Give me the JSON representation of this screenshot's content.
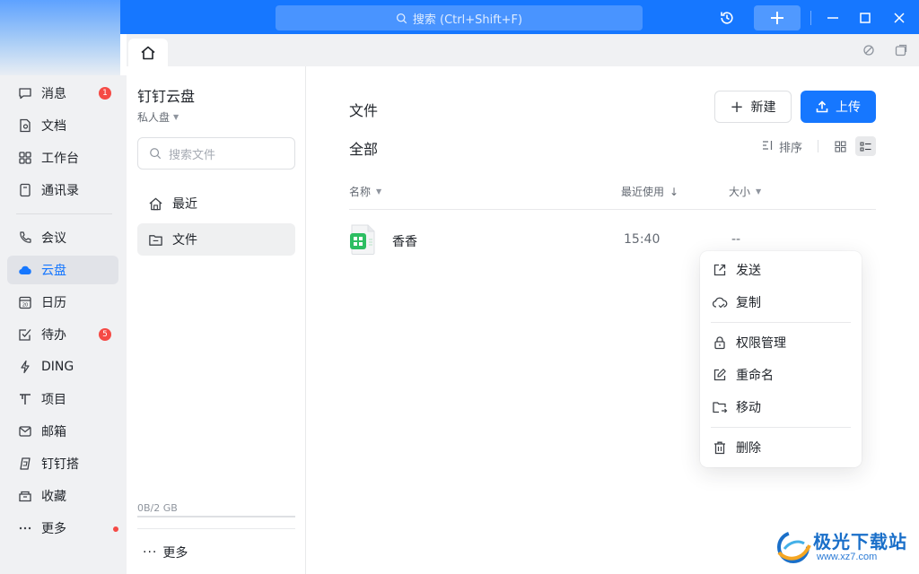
{
  "titlebar": {
    "search_placeholder": "搜索 (Ctrl+Shift+F)",
    "accent_color": "#1677ff"
  },
  "leftnav": {
    "items": [
      {
        "label": "消息",
        "icon": "message-icon",
        "badge": "1"
      },
      {
        "label": "文档",
        "icon": "document-icon"
      },
      {
        "label": "工作台",
        "icon": "workbench-icon"
      },
      {
        "label": "通讯录",
        "icon": "contacts-icon"
      },
      {
        "label": "会议",
        "icon": "meeting-icon"
      },
      {
        "label": "云盘",
        "icon": "cloud-icon",
        "active": true
      },
      {
        "label": "日历",
        "icon": "calendar-icon"
      },
      {
        "label": "待办",
        "icon": "todo-icon",
        "badge": "5"
      },
      {
        "label": "DING",
        "icon": "ding-icon"
      },
      {
        "label": "项目",
        "icon": "project-icon"
      },
      {
        "label": "邮箱",
        "icon": "mail-icon"
      },
      {
        "label": "钉钉搭",
        "icon": "builder-icon"
      },
      {
        "label": "收藏",
        "icon": "favorites-icon"
      },
      {
        "label": "更多",
        "icon": "more-icon",
        "dot": true
      }
    ]
  },
  "drive": {
    "title": "钉钉云盘",
    "subtitle": "私人盘",
    "search_placeholder": "搜索文件",
    "nav": [
      {
        "label": "最近",
        "icon": "home-icon"
      },
      {
        "label": "文件",
        "icon": "folder-icon",
        "active": true
      }
    ],
    "storage_text": "0B/2 GB",
    "storage_used_fraction": 0,
    "more_label": "更多"
  },
  "main": {
    "title": "文件",
    "new_button": "新建",
    "upload_button": "上传",
    "section_title": "全部",
    "sort_label": "排序",
    "columns": {
      "name": "名称",
      "recent": "最近使用",
      "size": "大小"
    },
    "files": [
      {
        "name": "香香",
        "time": "15:40",
        "size": "--",
        "icon": "spreadsheet-file-icon"
      }
    ]
  },
  "context_menu": {
    "items": [
      {
        "label": "发送",
        "icon": "send-icon"
      },
      {
        "label": "复制",
        "icon": "cloud-copy-icon"
      },
      {
        "label": "权限管理",
        "icon": "lock-icon"
      },
      {
        "label": "重命名",
        "icon": "rename-icon"
      },
      {
        "label": "移动",
        "icon": "move-icon"
      },
      {
        "label": "删除",
        "icon": "trash-icon"
      }
    ]
  },
  "watermark": {
    "text_cn": "极光下载站",
    "text_url": "www.xz7.com"
  }
}
